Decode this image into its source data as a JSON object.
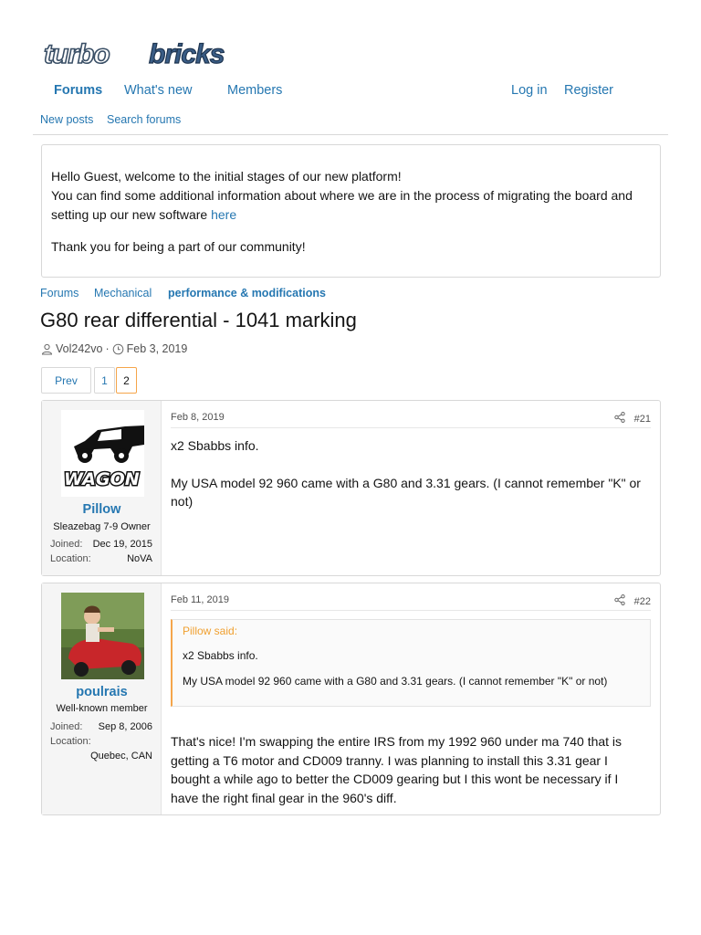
{
  "site": {
    "logo_text": "turbobricks",
    "logo_part1": "turbo",
    "logo_part2": "bricks"
  },
  "nav": {
    "forums": "Forums",
    "whats_new": "What's new",
    "members": "Members",
    "login": "Log in",
    "register": "Register"
  },
  "subnav": {
    "new_posts": "New posts",
    "search_forums": "Search forums"
  },
  "notice": {
    "line1": "Hello Guest, welcome to the initial stages of our new platform!",
    "line2_prefix": "You can find some additional information about where we are in the process of migrating the board and setting up our new software ",
    "line2_link": "here",
    "line3": "Thank you for being a part of our community!"
  },
  "breadcrumb": [
    "Forums",
    "Mechanical",
    "performance & modifications"
  ],
  "thread": {
    "title": "G80 rear differential - 1041 marking",
    "author": "Vol242vo",
    "separator": "·",
    "date": "Feb 3, 2019"
  },
  "pagination": {
    "prev": "Prev",
    "page1": "1",
    "page2": "2",
    "current_page": 2
  },
  "posts": [
    {
      "username": "Pillow",
      "user_title": "Sleazebag 7-9 Owner",
      "joined_label": "Joined:",
      "joined": "Dec 19, 2015",
      "location_label": "Location:",
      "location": "NoVA",
      "avatar_text": "WAGON",
      "date": "Feb 8, 2019",
      "number": "#21",
      "body": [
        "x2 Sbabbs info.",
        "My USA model 92 960 came with a G80 and 3.31 gears. (I cannot remember \"K\" or not)"
      ]
    },
    {
      "username": "poulrais",
      "user_title": "Well-known member",
      "joined_label": "Joined:",
      "joined": "Sep 8, 2006",
      "location_label": "Location:",
      "location": "Quebec, CAN",
      "date": "Feb 11, 2019",
      "number": "#22",
      "quote": {
        "author": "Pillow said:",
        "lines": [
          "x2 Sbabbs info.",
          "My USA model 92 960 came with a G80 and 3.31 gears. (I cannot remember \"K\" or not)"
        ]
      },
      "body": [
        "That's nice! I'm swapping the entire IRS from my 1992 960 under ma 740 that is getting a T6 motor and CD009 tranny. I was planning to install this 3.31 gear I bought a while ago to better the CD009 gearing but I this wont be necessary if I have the right final gear in the 960's diff."
      ]
    }
  ],
  "icons": {
    "user": "user-icon",
    "clock": "clock-icon",
    "share": "share-icon"
  },
  "colors": {
    "link": "#2577b1",
    "accent": "#f5a54a",
    "border": "#d8d8d8"
  }
}
